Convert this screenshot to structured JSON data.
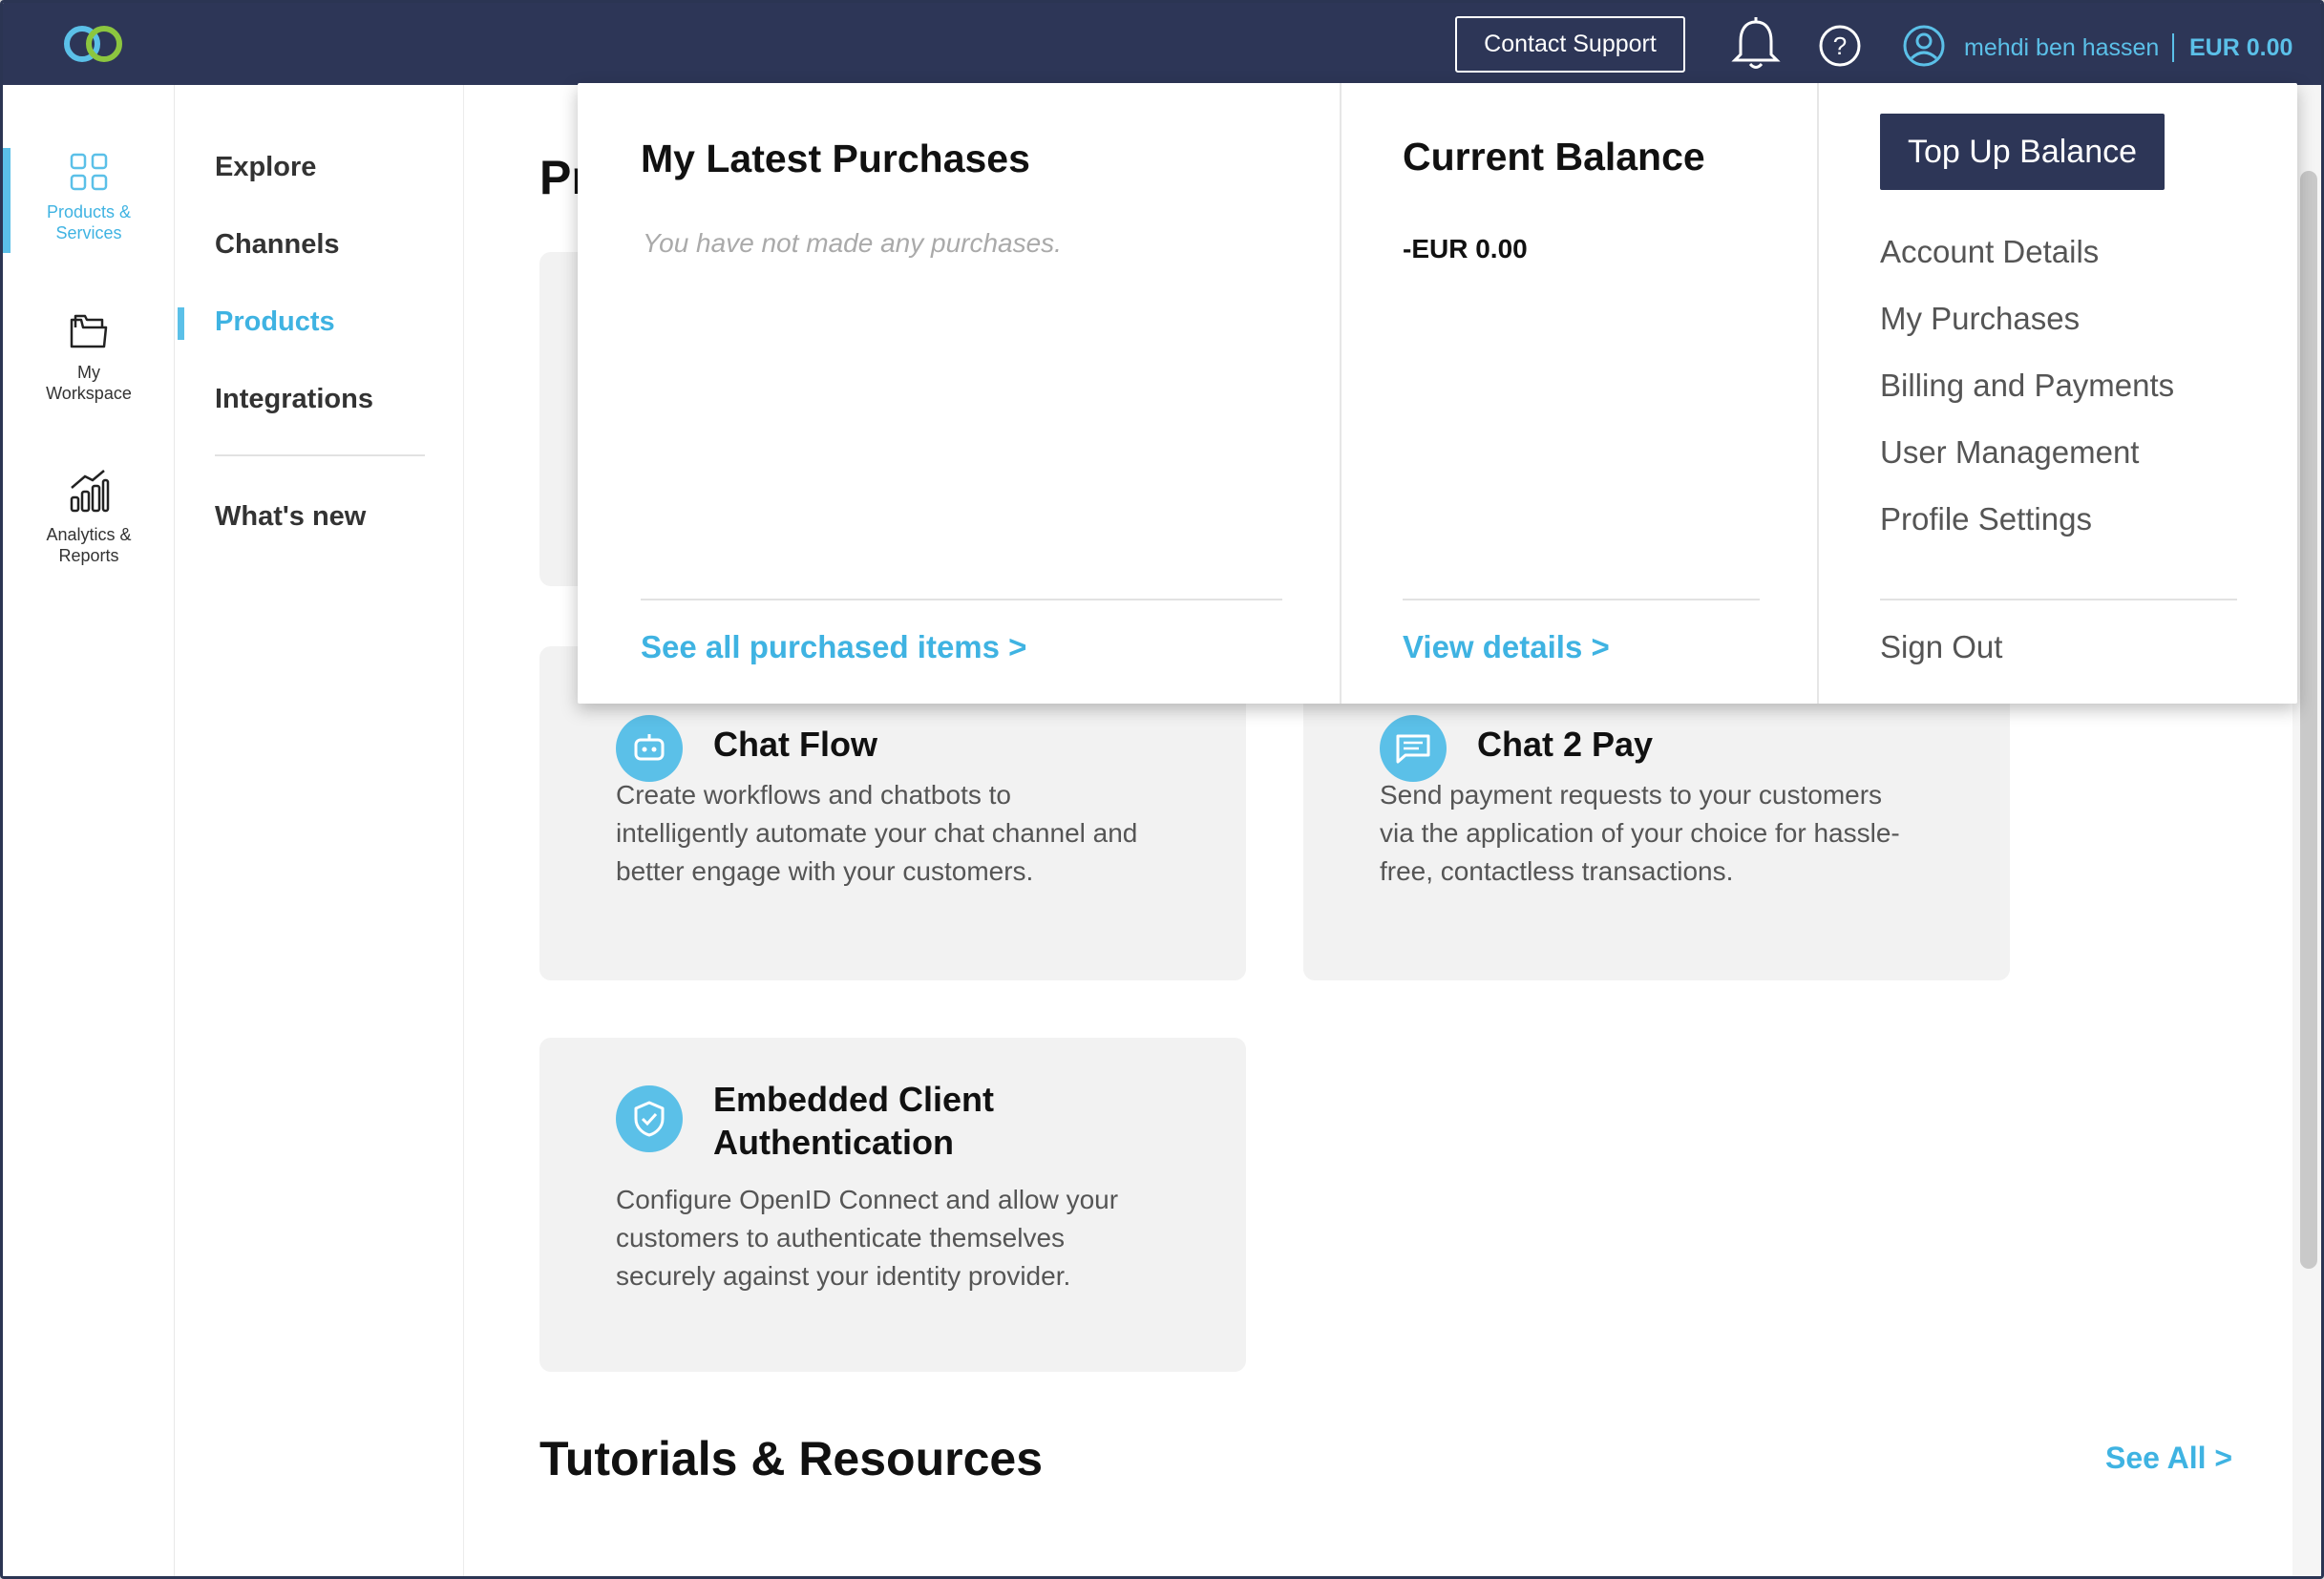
{
  "topbar": {
    "contact_support": "Contact Support",
    "user_name": "mehdi ben hassen",
    "balance": "EUR 0.00"
  },
  "rail": {
    "items": [
      {
        "label_1": "Products &",
        "label_2": "Services",
        "icon": "grid-icon"
      },
      {
        "label_1": "My",
        "label_2": "Workspace",
        "icon": "folder-icon"
      },
      {
        "label_1": "Analytics &",
        "label_2": "Reports",
        "icon": "analytics-icon"
      }
    ]
  },
  "subnav": {
    "items": [
      "Explore",
      "Channels",
      "Products",
      "Integrations",
      "What's new"
    ]
  },
  "main": {
    "page_title": "Pr",
    "cards": [
      {
        "title": "Chat Flow",
        "desc_1": "Create workflows and chatbots to",
        "desc_2": "intelligently automate your chat channel and",
        "desc_3": "better engage with your customers."
      },
      {
        "title": "Chat 2 Pay",
        "desc_1": "Send payment requests to your customers",
        "desc_2": "via the application of your choice for hassle-",
        "desc_3": "free, contactless transactions."
      },
      {
        "title_1": "Embedded Client",
        "title_2": "Authentication",
        "desc_1": "Configure OpenID Connect and allow your",
        "desc_2": "customers to authenticate themselves",
        "desc_3": "securely against your identity provider."
      }
    ],
    "tutorials_title": "Tutorials & Resources",
    "see_all": "See All >"
  },
  "dropdown": {
    "purchases_title": "My Latest Purchases",
    "purchases_empty": "You have not made any purchases.",
    "purchases_link": "See all purchased items >",
    "balance_title": "Current Balance",
    "balance_value": "-EUR 0.00",
    "balance_link": "View details >",
    "top_up": "Top Up Balance",
    "account_items": [
      "Account Details",
      "My Purchases",
      "Billing and Payments",
      "User Management",
      "Profile Settings"
    ],
    "sign_out": "Sign Out"
  },
  "colors": {
    "header_bg": "#2d3657",
    "accent": "#5bc0e8",
    "card_bg": "#f2f2f2"
  }
}
